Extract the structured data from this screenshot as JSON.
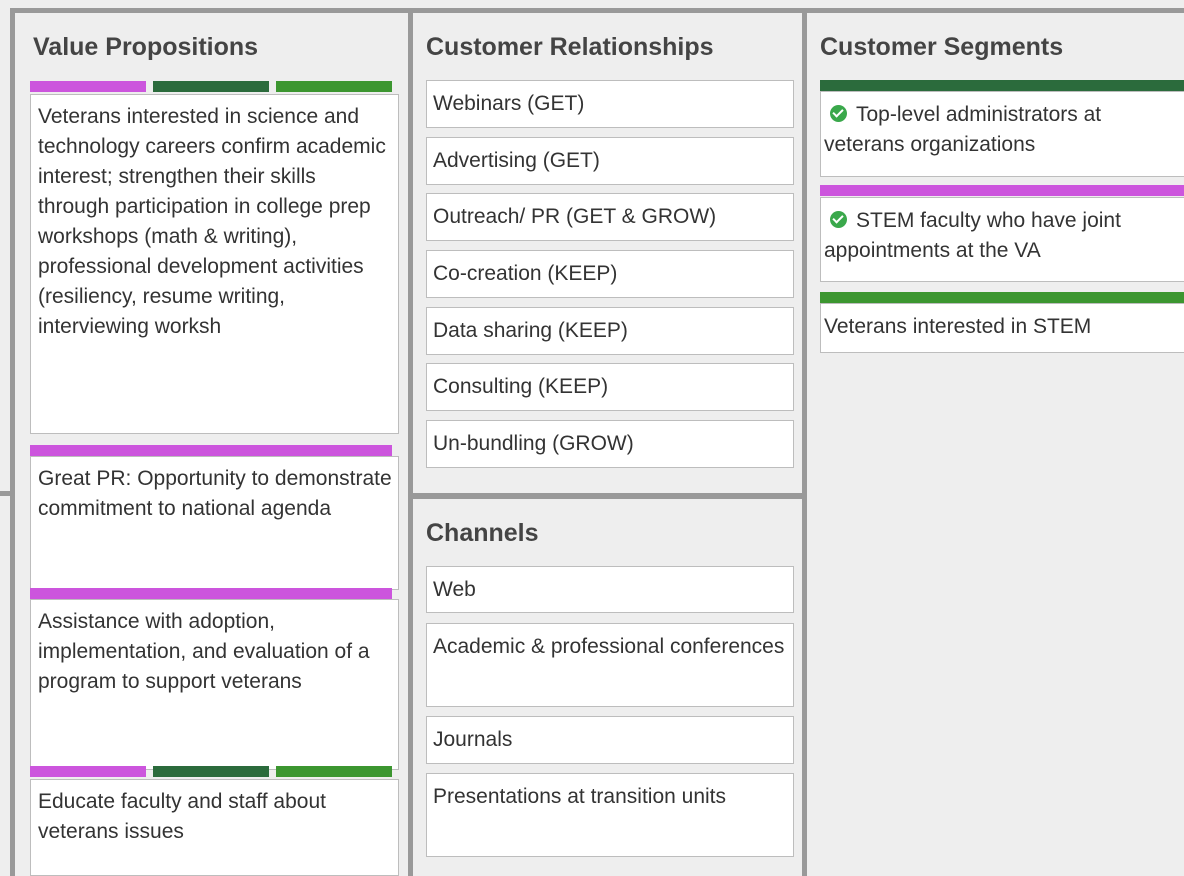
{
  "colors": {
    "magenta": "#cc55dd",
    "dark_green": "#2b6b3c",
    "green": "#3c9630",
    "check_green": "#3aa84b"
  },
  "value_propositions": {
    "title": "Value Propositions",
    "cards": [
      {
        "text": "Veterans interested in science and technology careers confirm academic interest; strengthen their skills through participation in college prep workshops (math & writing), professional development activities (resiliency, resume writing, interviewing worksh",
        "tags": [
          "magenta",
          "dark_green",
          "green"
        ]
      },
      {
        "text": "Great PR: Opportunity to demonstrate commitment to national agenda",
        "tags": [
          "magenta"
        ]
      },
      {
        "text": "Assistance with adoption, implementation, and evaluation of a program to support veterans",
        "tags": [
          "magenta"
        ]
      },
      {
        "text": "Educate faculty and staff about veterans issues",
        "tags": [
          "magenta",
          "dark_green",
          "green"
        ]
      }
    ]
  },
  "customer_relationships": {
    "title": "Customer Relationships",
    "items": [
      "Webinars (GET)",
      "Advertising (GET)",
      "Outreach/ PR (GET & GROW)",
      "Co-creation (KEEP)",
      "Data sharing (KEEP)",
      "Consulting (KEEP)",
      "Un-bundling (GROW)"
    ]
  },
  "channels": {
    "title": "Channels",
    "items": [
      "Web",
      "Academic & professional conferences",
      "Journals",
      "Presentations at transition units"
    ]
  },
  "customer_segments": {
    "title": "Customer Segments",
    "items": [
      {
        "text": "Top-level administrators at veterans organizations",
        "tag": "dark_green",
        "checked": true,
        "icon": "check-circle-icon"
      },
      {
        "text": "STEM faculty who have joint appointments at the VA",
        "tag": "magenta",
        "checked": true,
        "icon": "check-circle-icon"
      },
      {
        "text": "Veterans interested in STEM",
        "tag": "green",
        "checked": false
      }
    ]
  }
}
